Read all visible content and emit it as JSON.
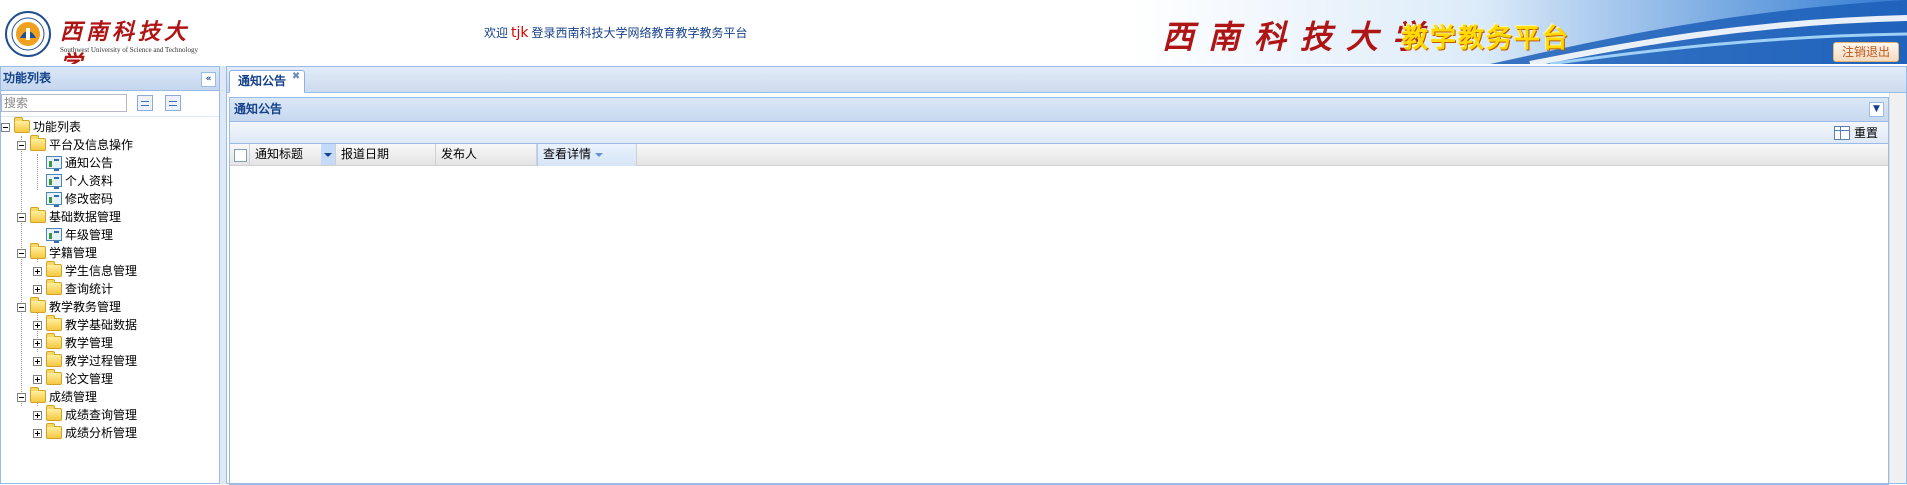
{
  "header": {
    "logo_cn": "西南科技大学",
    "logo_en": "Southwest University of Science and Technology",
    "welcome_prefix": "欢迎",
    "username": "tjk",
    "welcome_suffix": "登录西南科技大学网络教育教学教务平台",
    "banner_cn": "西南科技大学",
    "banner_sub": "教学教务平台",
    "logout_label": "注销退出"
  },
  "west": {
    "title": "功能列表",
    "collapse_icon": "double-chevron-left-icon",
    "search_placeholder": "搜索",
    "tree": {
      "root": "功能列表",
      "groups": [
        {
          "label": "平台及信息操作",
          "children": [
            {
              "label": "通知公告",
              "type": "leaf"
            },
            {
              "label": "个人资料",
              "type": "leaf"
            },
            {
              "label": "修改密码",
              "type": "leaf"
            }
          ]
        },
        {
          "label": "基础数据管理",
          "children": [
            {
              "label": "年级管理",
              "type": "leaf"
            }
          ]
        },
        {
          "label": "学籍管理",
          "children": [
            {
              "label": "学生信息管理",
              "type": "folder"
            },
            {
              "label": "查询统计",
              "type": "folder"
            }
          ]
        },
        {
          "label": "教学教务管理",
          "children": [
            {
              "label": "教学基础数据",
              "type": "folder"
            },
            {
              "label": "教学管理",
              "type": "folder"
            },
            {
              "label": "教学过程管理",
              "type": "folder"
            },
            {
              "label": "论文管理",
              "type": "folder"
            }
          ]
        },
        {
          "label": "成绩管理",
          "children": [
            {
              "label": "成绩查询管理",
              "type": "folder"
            },
            {
              "label": "成绩分析管理",
              "type": "folder"
            }
          ]
        }
      ]
    }
  },
  "center": {
    "tab_label": "通知公告",
    "tab_close_icon": "close-icon",
    "panel_title": "通知公告",
    "panel_collapse_icon": "chevron-down-icon",
    "toolbar": {
      "reset_label": "重置"
    },
    "grid": {
      "columns": [
        {
          "label": "通知标题"
        },
        {
          "label": "报道日期"
        },
        {
          "label": "发布人"
        },
        {
          "label": "查看详情"
        }
      ],
      "rows": []
    }
  },
  "colors": {
    "accent_blue": "#15428b",
    "border_blue": "#99bbe8",
    "brand_red": "#b01515",
    "username_red": "#d40000",
    "banner_yellow": "#ffd900"
  }
}
